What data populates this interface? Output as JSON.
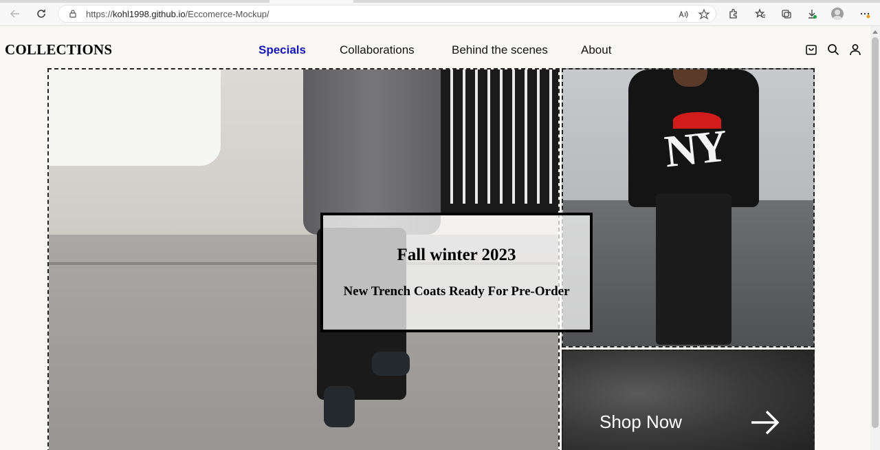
{
  "browser": {
    "url_prefix": "https://",
    "url_host": "kohl1998.github.io",
    "url_path": "/Eccomerce-Mockup/"
  },
  "header": {
    "brand": "COLLECTIONS",
    "nav": [
      {
        "label": "Specials",
        "active": true
      },
      {
        "label": "Collaborations",
        "active": false
      },
      {
        "label": "Behind the scenes",
        "active": false
      },
      {
        "label": "About",
        "active": false
      }
    ],
    "icons": [
      "shopping-bag-icon",
      "search-icon",
      "user-icon"
    ]
  },
  "hero": {
    "promo_title": "Fall winter 2023",
    "promo_subtitle": "New Trench Coats Ready For Pre-Order",
    "shop_now": "Shop Now",
    "top_graphic_text": "NY"
  },
  "colors": {
    "active_nav": "#1515b5",
    "page_bg": "#f9f8f5"
  }
}
